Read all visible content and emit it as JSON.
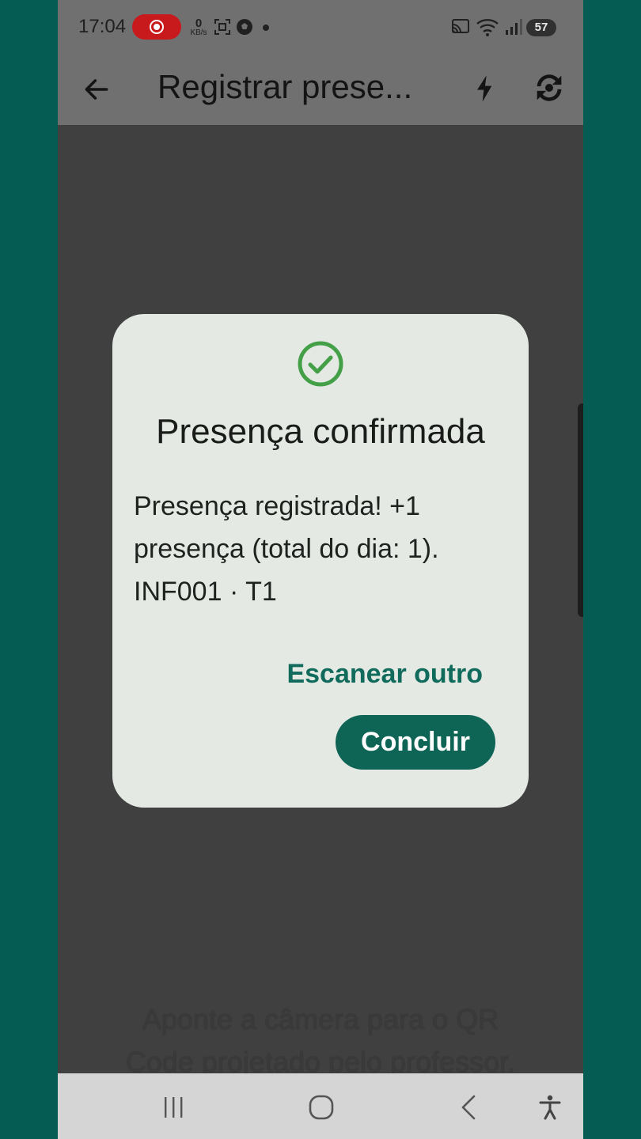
{
  "status_bar": {
    "time": "17:04",
    "net_speed_value": "0",
    "net_speed_unit": "KB/s",
    "battery": "57"
  },
  "app_bar": {
    "title": "Registrar prese..."
  },
  "dialog": {
    "title": "Presença confirmada",
    "message_line1": "Presença registrada! +1",
    "message_line2": "presença (total do dia: 1).",
    "message_line3": "INF001 · T1",
    "secondary_action": "Escanear outro",
    "primary_action": "Concluir"
  },
  "camera": {
    "hint_line1": "Aponte a câmera para o QR",
    "hint_line2": "Code projetado pelo professor."
  },
  "colors": {
    "accent": "#0e6555",
    "success": "#43a047",
    "background": "#055c52"
  }
}
